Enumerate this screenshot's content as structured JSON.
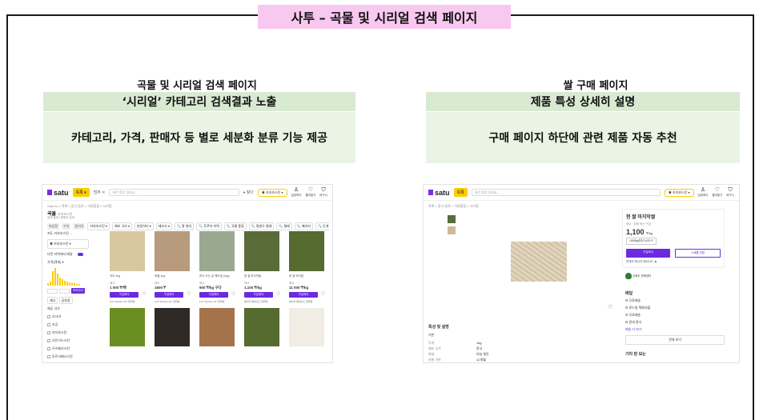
{
  "page": {
    "title": "사투 – 곡물 및 시리얼 검색 페이지",
    "accent_pink": "#f8c8f0",
    "accent_green": "#d9ead3",
    "brand_purple": "#6a2be0",
    "brand_yellow": "#ffcc00"
  },
  "left": {
    "heading": "곡물 및 시리얼 검색 페이지",
    "strip": "‘시리얼’ 카테고리 검색결과 노출",
    "box": "카테고리, 가격, 판매자 등 별로 세분화 분류 기능 제공"
  },
  "right": {
    "heading": "쌀 구매 페이지",
    "strip": "제품 특성 상세히 설명",
    "box": "구매 페이지 하단에 관련 제품 자동 추천"
  },
  "shot1": {
    "logo": "satu",
    "cat_btn": "목록 ▾",
    "mini1": "범주 ✕",
    "search_placeholder": "제안 항로 정비요...",
    "mini2": "♦ 찾다",
    "location": "◉ 카자흐스탄   ▾",
    "icons": [
      {
        "icon": "user-icon",
        "label": "입장하다"
      },
      {
        "icon": "heart-icon",
        "label": "즐겨찾기"
      },
      {
        "icon": "cart-icon",
        "label": "바구니"
      }
    ],
    "crumbs": "Satu.kz  >  목록  >  음식 음료  >  식료품점  >  시리얼",
    "title": "곡물",
    "title_note": "카자흐스탄",
    "sub": "검색 결과 | 판매자 검색",
    "filters": [
      "카자흐스탄 ▾",
      "제조 국가 ▾",
      "분류하다 ▾",
      "제조사 ▾",
      "🔍 팔 위치",
      "🔍 후쿠자 속력",
      "🔍 곡물 종류",
      "🔍 밀봉도 형태",
      "🔍 형태",
      "🔍 패키지",
      "🔍 무게",
      "⚙"
    ],
    "chips": [
      "초심정",
      "우리",
      "음미국"
    ],
    "sidebar": {
      "label1": "지도 카자흐스탄 ...",
      "select1": "◉ 카자흐스탄 ▾",
      "toggle_label": "다른 지역에서 배달",
      "price_label": "가격(텐게) ▾",
      "go": "보여주다",
      "btn_a": "재고",
      "btn_b": "공유량",
      "list_label": "제공 국가",
      "items": [
        "러시아",
        "조공",
        "카자흐스탄",
        "키르기스스탄",
        "우즈베키스탄",
        "투르크메니스탄"
      ]
    },
    "cards": [
      {
        "name": "귀리 1kg",
        "weight": "재고",
        "price": "1 000 ₸/백",
        "btn": "구입하다",
        "seller": "LLP \"Danten-15\" 찰뤼에",
        "img": "#d8c7a0"
      },
      {
        "name": "퍼플 1kg",
        "weight": "재고",
        "price": "1600 ₸",
        "btn": "구입하다",
        "seller": "LLP \"Danten-15\" 찰뤼에",
        "img": "#b89a7c"
      },
      {
        "name": "하다 오는 날 헤어겜 (1kg)",
        "weight": "재고",
        "price": "900 ₸/kg 구다",
        "btn": "구입하다",
        "seller": "LLP \"Danten-15\" 찰뤼에",
        "img": "#9aa88f"
      },
      {
        "name": "현 쌀 마지막쌀",
        "weight": "재고",
        "price": "1,100 ₸/kg",
        "btn": "구입하다",
        "seller": "에너지 페셔나드 찰뤼에",
        "img": "#5a6b3a"
      },
      {
        "name": "퀸 쌀 보리쌀",
        "weight": "재고",
        "price": "11 000 ₸/kg",
        "btn": "구입하다",
        "seller": "에너지 페셔나드 찰뤼에",
        "img": "#556b2f"
      }
    ],
    "row2_imgs": [
      "#6b8e23",
      "#2f2a26",
      "#a5734a",
      "#556b2f",
      "#f2ede4"
    ]
  },
  "shot2": {
    "logo": "satu",
    "cat_btn": "목록",
    "search_placeholder": "제안 항로 정비요...",
    "location": "◉ 카자흐스탄 ▾",
    "icons": [
      {
        "icon": "user-icon",
        "label": "입장하다"
      },
      {
        "icon": "heart-icon",
        "label": "즐겨찾기"
      },
      {
        "icon": "cart-icon",
        "label": "바구니"
      }
    ],
    "crumbs": "목록  >  음식 음료  >  식료품점  >  시리얼",
    "panel": {
      "title": "현 쌀 마지막쌀",
      "meta": "재고 · 균형 또는 구입",
      "price": "1,100",
      "unit": "₸/kg",
      "option": "1000kg부터 1100 ₸",
      "buy": "구입하다",
      "cart": "시세를 전환",
      "seller": "판매자    에너지 페셔나드 ★"
    },
    "badge": "신뢰도 판매센터",
    "delivery": {
      "title": "배달",
      "rows": [
        "⊟ 무료배송",
        "⊟ 로드원 택배지불",
        "⊟ 무료배송",
        "⊟ 관세 정사"
      ],
      "more": "배송 더 보기",
      "all": "전체 보기"
    },
    "spec": {
      "title": "특성 및 설명",
      "section": "기본",
      "rows": [
        {
          "k": "무게",
          "v": "1kg"
        },
        {
          "k": "제조 국가",
          "v": "한국"
        },
        {
          "k": "형태",
          "v": "비닐 봉투"
        },
        {
          "k": "유통 기한",
          "v": "12개월"
        }
      ]
    },
    "related": "기타 판 보는"
  }
}
